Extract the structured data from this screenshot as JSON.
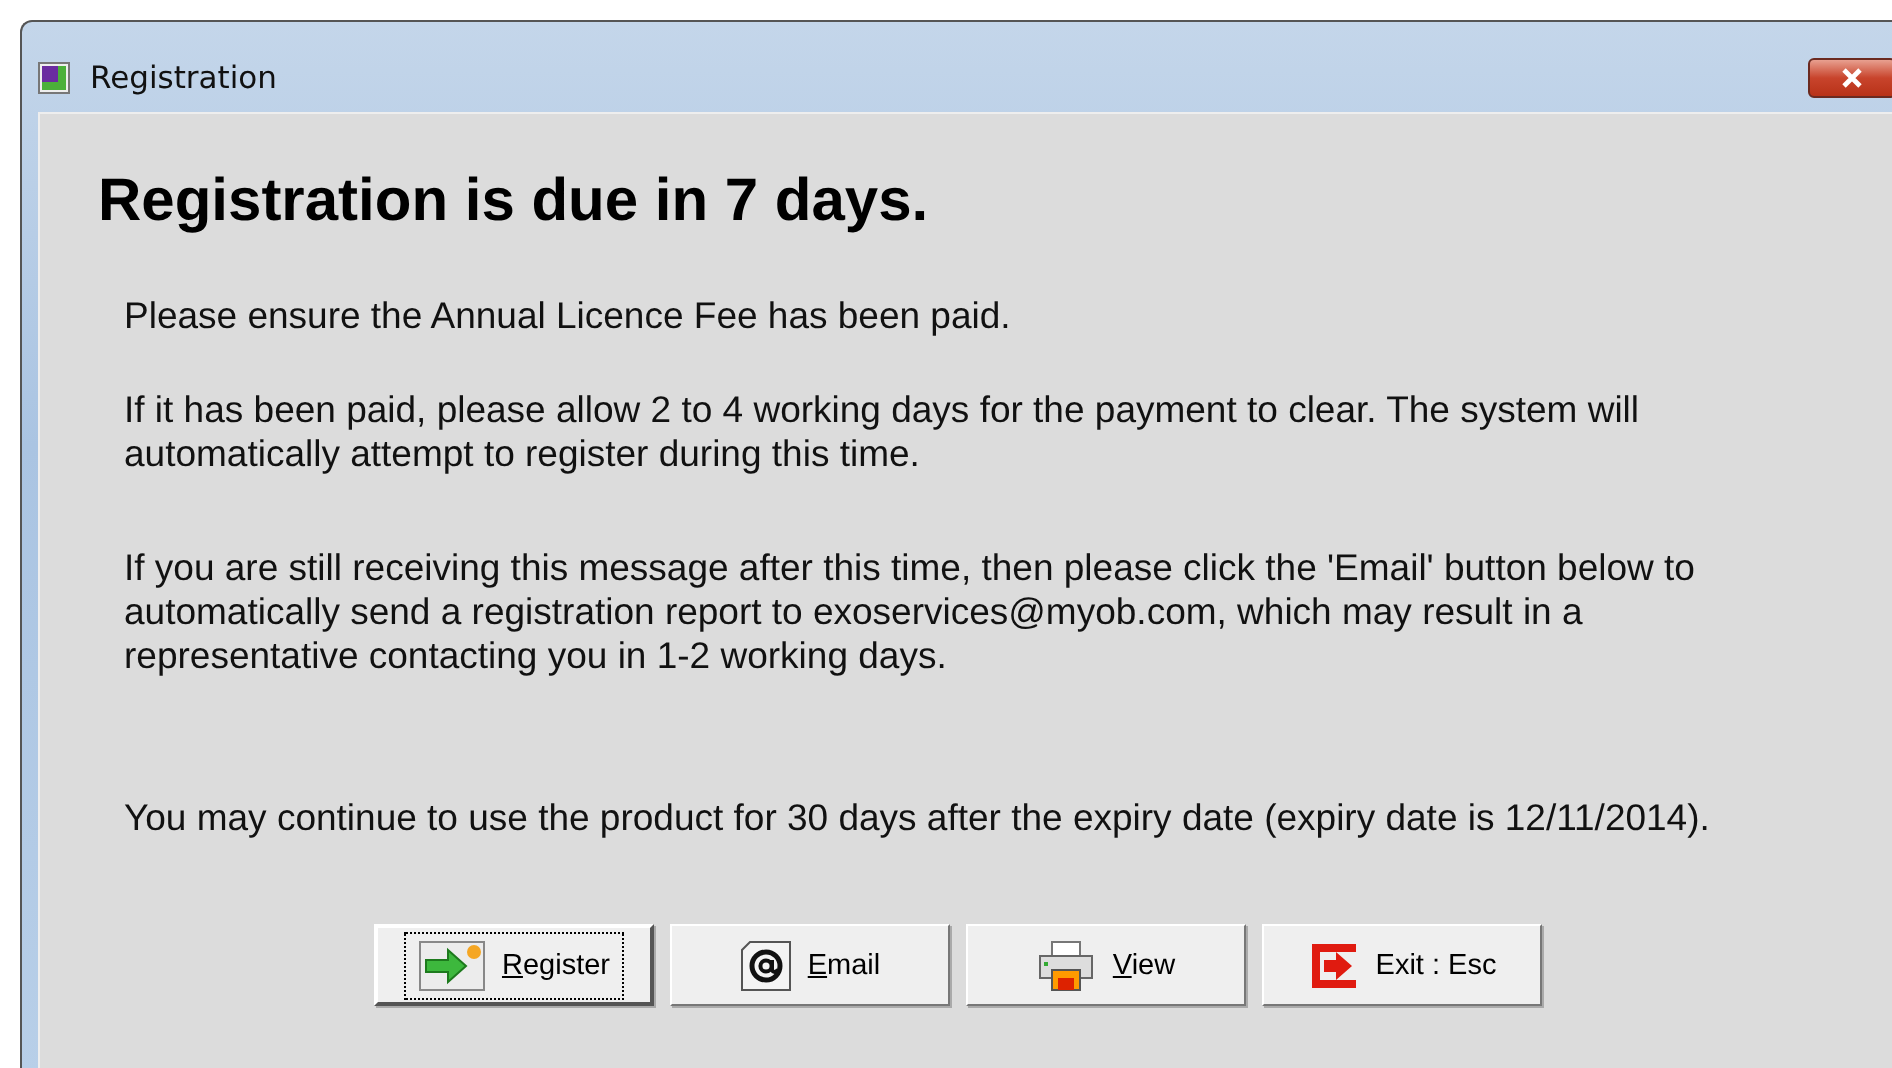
{
  "window": {
    "title": "Registration"
  },
  "heading": "Registration is due in 7 days.",
  "paragraphs": [
    "Please ensure the Annual Licence Fee has been paid.",
    "If it has been paid, please allow 2 to 4 working days for the payment to clear. The system will automatically attempt to register during this time.",
    "If you are still receiving this message after this time, then please click the 'Email' button below to automatically send a registration report to exoservices@myob.com, which may result in a representative contacting you in 1-2 working days.",
    "You may continue to use the product for 30 days after the expiry date (expiry date is 12/11/2014)."
  ],
  "buttons": [
    {
      "label": "Register",
      "kind": "register",
      "mnemonic": true,
      "focused": true
    },
    {
      "label": "Email",
      "kind": "email",
      "mnemonic": true,
      "focused": false
    },
    {
      "label": "View",
      "kind": "view",
      "mnemonic": true,
      "focused": false
    },
    {
      "label": "Exit : Esc",
      "kind": "exit",
      "mnemonic": false,
      "focused": false
    }
  ]
}
